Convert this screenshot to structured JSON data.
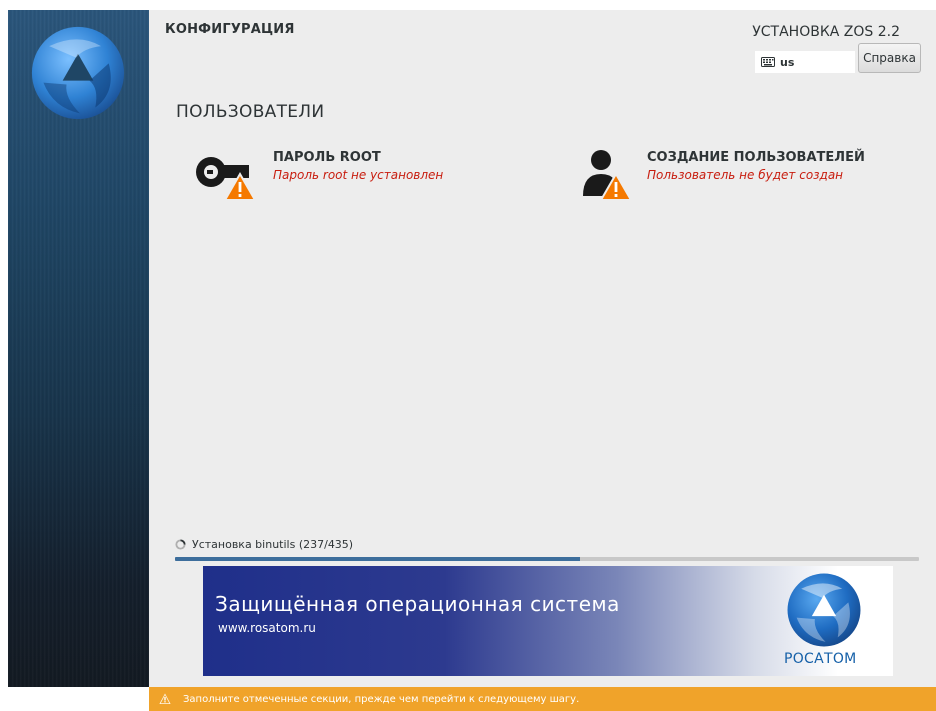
{
  "header": {
    "spoke_title": "КОНФИГУРАЦИЯ",
    "product_title": "УСТАНОВКА ZOS 2.2",
    "keyboard_layout": "us",
    "help_label": "Справка"
  },
  "users": {
    "category_title": "ПОЛЬЗОВАТЕЛИ",
    "root_password": {
      "name": "ПАРОЛЬ ROOT",
      "status": "Пароль root не установлен",
      "icon": "key-warning-icon"
    },
    "user_creation": {
      "name": "СОЗДАНИЕ ПОЛЬЗОВАТЕЛЕЙ",
      "status": "Пользователь не будет создан",
      "icon": "user-warning-icon"
    }
  },
  "progress": {
    "label": "Установка binutils (237/435)",
    "fraction": 0.545
  },
  "banner": {
    "title": "Защищённая операционная система",
    "url": "www.rosatom.ru",
    "brand": "РОСАТОМ"
  },
  "warning": {
    "text": "Заполните отмеченные секции, прежде чем перейти к следующему шагу."
  },
  "colors": {
    "accent_progress": "#3d6e9c",
    "warning_bar": "#f0a32a",
    "status_error": "#c81d0f",
    "warning_triangle": "#f57900"
  }
}
